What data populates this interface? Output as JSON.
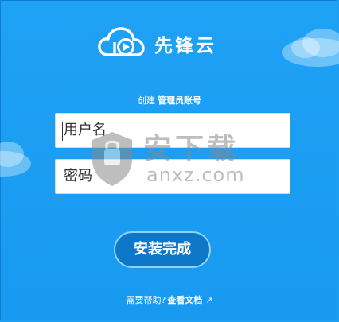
{
  "brand": {
    "name": "先锋云",
    "logo_icon": "cloud-play-icon"
  },
  "setup": {
    "prefix": "创建",
    "title": "管理员账号"
  },
  "form": {
    "username": {
      "value": "",
      "placeholder": "用户名"
    },
    "password": {
      "value": "",
      "placeholder": "密码"
    },
    "submit_label": "安装完成"
  },
  "help": {
    "text": "需要帮助?",
    "link": "查看文档",
    "link_icon": "external-link-icon"
  },
  "watermark": {
    "cn": "安下载",
    "en": "anxz.com"
  },
  "colors": {
    "background": "#1d9ef3",
    "button": "#0f77c8"
  }
}
